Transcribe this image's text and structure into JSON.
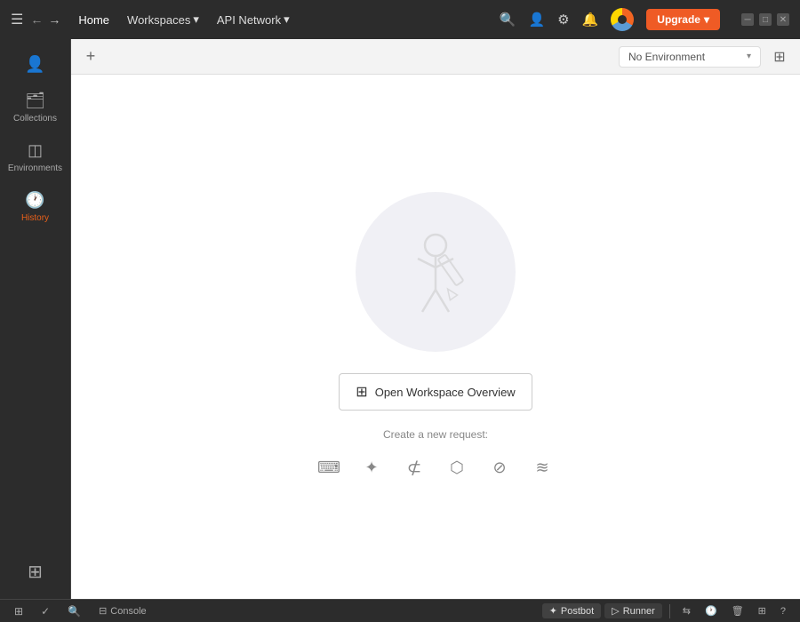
{
  "titlebar": {
    "menu_items": [
      {
        "label": "Home",
        "active": true
      },
      {
        "label": "Workspaces",
        "has_arrow": true
      },
      {
        "label": "API Network",
        "has_arrow": true
      }
    ],
    "upgrade_label": "Upgrade",
    "icons": {
      "search": "🔍",
      "add_user": "👤+",
      "settings": "⚙",
      "bell": "🔔"
    }
  },
  "tabbar": {
    "add_label": "+",
    "env_label": "No Environment",
    "env_placeholder": "No Environment"
  },
  "sidebar": {
    "items": [
      {
        "label": "",
        "icon": "👤",
        "name": "profile",
        "active": false
      },
      {
        "label": "Collections",
        "icon": "🗑",
        "name": "collections",
        "active": false
      },
      {
        "label": "Environments",
        "icon": "⊟",
        "name": "environments",
        "active": false
      },
      {
        "label": "History",
        "icon": "🕐",
        "name": "history",
        "active": true
      },
      {
        "label": "",
        "icon": "⊞+",
        "name": "add-workspace",
        "active": false
      }
    ]
  },
  "main": {
    "open_workspace_label": "Open Workspace Overview",
    "create_request_label": "Create a new request:",
    "request_icons": [
      {
        "name": "http-icon",
        "symbol": "⌨",
        "tooltip": "HTTP"
      },
      {
        "name": "graphql-icon",
        "symbol": "✦",
        "tooltip": "GraphQL"
      },
      {
        "name": "grpc-icon",
        "symbol": "⊄",
        "tooltip": "gRPC"
      },
      {
        "name": "websocket-icon",
        "symbol": "⬡",
        "tooltip": "WebSocket"
      },
      {
        "name": "socketio-icon",
        "symbol": "⊘",
        "tooltip": "Socket.IO"
      },
      {
        "name": "mqtt-icon",
        "symbol": "≋",
        "tooltip": "MQTT"
      }
    ]
  },
  "statusbar": {
    "left_items": [
      {
        "label": "",
        "icon": "⊞",
        "name": "workspace-status"
      },
      {
        "label": "",
        "icon": "✓",
        "name": "check-status"
      },
      {
        "label": "",
        "icon": "🔍",
        "name": "search-status"
      }
    ],
    "console_label": "Console",
    "postbot_label": "Postbot",
    "runner_label": "Runner",
    "right_icons": [
      "⇆",
      "🕐",
      "🗑",
      "⊞",
      "?"
    ]
  }
}
